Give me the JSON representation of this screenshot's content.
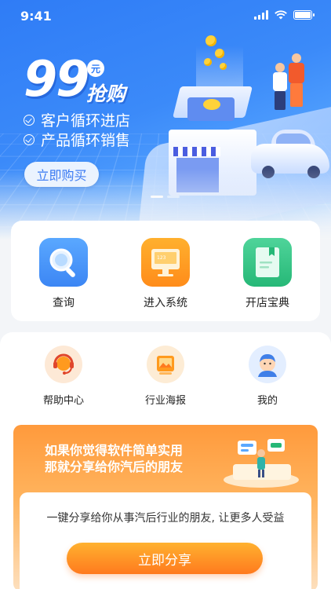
{
  "status_bar": {
    "time": "9:41"
  },
  "banner": {
    "price": "99",
    "price_unit": "元",
    "price_suffix": "抢购",
    "features": [
      "客户循环进店",
      "产品循环销售"
    ],
    "cta": "立即购买",
    "carousel": {
      "count": 2,
      "active": 0
    }
  },
  "main_menu": [
    {
      "label": "查询",
      "icon": "search-icon"
    },
    {
      "label": "进入系统",
      "icon": "monitor-icon"
    },
    {
      "label": "开店宝典",
      "icon": "book-icon"
    }
  ],
  "sub_menu": [
    {
      "label": "帮助中心",
      "icon": "headset-icon"
    },
    {
      "label": "行业海报",
      "icon": "poster-icon"
    },
    {
      "label": "我的",
      "icon": "avatar-icon"
    }
  ],
  "share": {
    "title_line1": "如果你觉得软件简单实用",
    "title_line2": "那就分享给你汽后的朋友",
    "description": "一键分享给你从事汽后行业的朋友, 让更多人受益",
    "button": "立即分享"
  },
  "colors": {
    "primary_blue": "#2f7cf6",
    "orange": "#ff8c1a",
    "green": "#26b877"
  }
}
